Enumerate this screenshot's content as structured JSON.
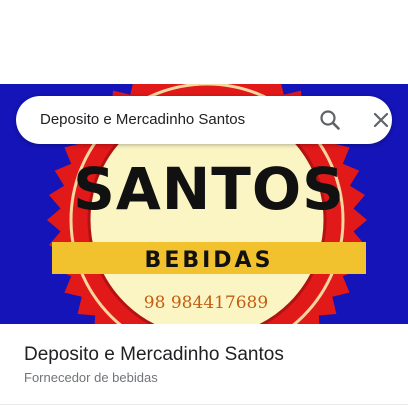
{
  "search": {
    "query": "Deposito e Mercadinho Santos",
    "search_icon": "search-icon",
    "close_icon": "close-icon"
  },
  "hero_image": {
    "logo_title": "SANTOS",
    "logo_banner": "BEBIDAS",
    "logo_phone": "98 984417689",
    "colors": {
      "background": "#1414b8",
      "seal_red": "#e11919",
      "seal_cream": "#fbf5c4",
      "banner_yellow": "#f2c12e",
      "phone_text": "#c45d12"
    }
  },
  "place": {
    "name": "Deposito e Mercadinho Santos",
    "category": "Fornecedor de bebidas"
  }
}
